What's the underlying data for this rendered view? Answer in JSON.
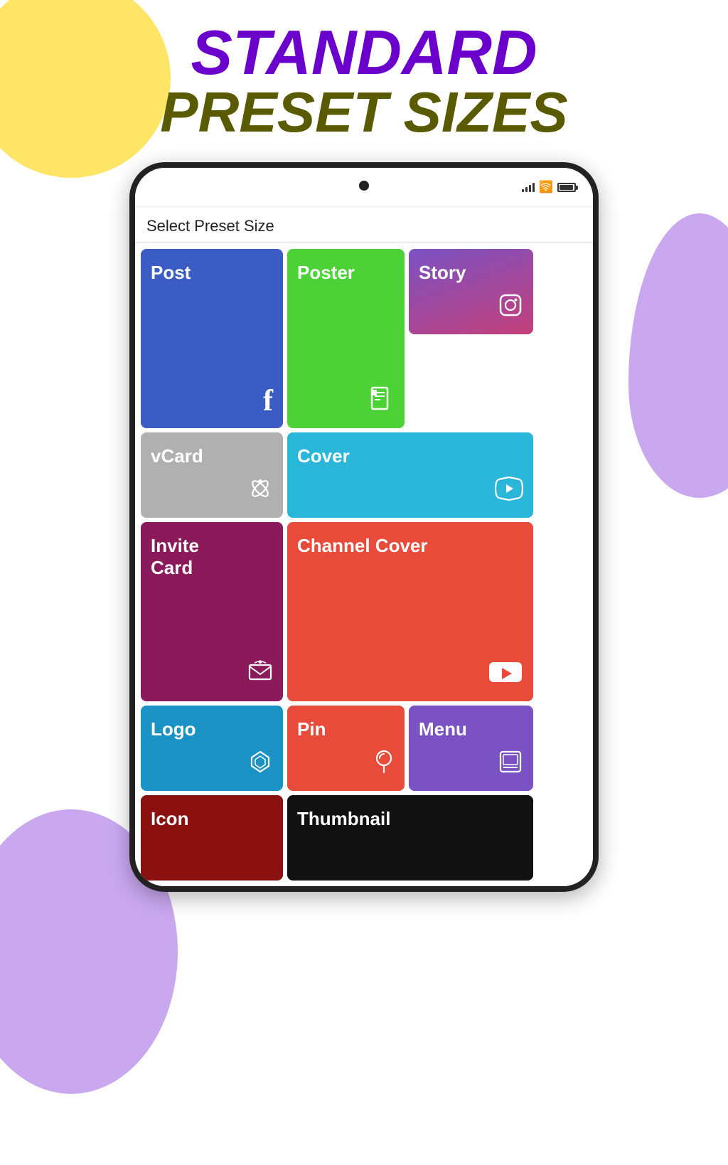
{
  "header": {
    "line1": "STANDARD",
    "line2": "PRESET SIZES"
  },
  "phone": {
    "screen_title": "Select Preset Size",
    "presets": [
      {
        "key": "post",
        "label": "Post",
        "icon": "f",
        "icon_type": "facebook"
      },
      {
        "key": "poster",
        "label": "Poster",
        "icon": "📋",
        "icon_type": "poster"
      },
      {
        "key": "story",
        "label": "Story",
        "icon": "📷",
        "icon_type": "instagram"
      },
      {
        "key": "vcard",
        "label": "vCard",
        "icon": "🚀",
        "icon_type": "rocket"
      },
      {
        "key": "cover",
        "label": "Cover",
        "icon": "🐦",
        "icon_type": "twitter"
      },
      {
        "key": "invite",
        "label": "Invite\nCard",
        "icon": "✉",
        "icon_type": "envelope"
      },
      {
        "key": "channel",
        "label": "Channel Cover",
        "icon": "▶",
        "icon_type": "youtube"
      },
      {
        "key": "logo",
        "label": "Logo",
        "icon": "◇",
        "icon_type": "logo"
      },
      {
        "key": "pin",
        "label": "Pin",
        "icon": "𝗣",
        "icon_type": "pinterest"
      },
      {
        "key": "menu",
        "label": "Menu",
        "icon": "☰",
        "icon_type": "menu"
      },
      {
        "key": "icon_item",
        "label": "Icon",
        "icon": "◇",
        "icon_type": "icon"
      },
      {
        "key": "thumbnail",
        "label": "Thumbnail",
        "icon": "",
        "icon_type": "thumbnail"
      }
    ]
  }
}
